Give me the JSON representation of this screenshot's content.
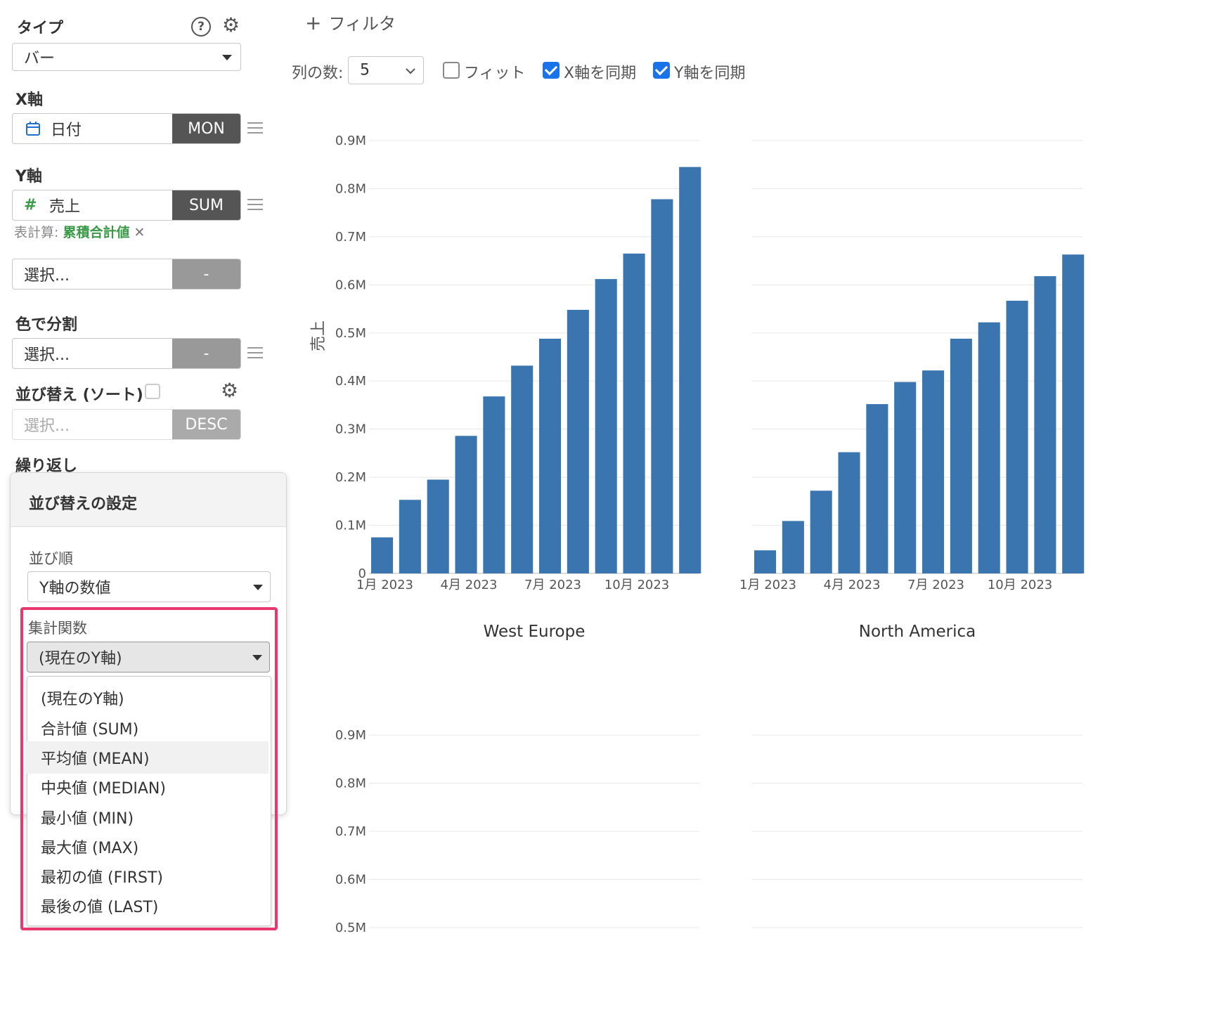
{
  "sidebar": {
    "type_title": "タイプ",
    "type_value": "バー",
    "xaxis_title": "X軸",
    "xaxis_field": "日付",
    "xaxis_agg": "MON",
    "yaxis_title": "Y軸",
    "yaxis_field": "売上",
    "yaxis_agg": "SUM",
    "table_calc_label": "表計算:",
    "table_calc_value": "累積合計値",
    "extra_select": "選択...",
    "extra_select_agg": "-",
    "color_title": "色で分割",
    "color_select": "選択...",
    "color_agg": "-",
    "sort_title": "並び替え (ソート)",
    "sort_select": "選択...",
    "sort_agg": "DESC",
    "repeat_title": "繰り返し"
  },
  "sort_panel": {
    "title": "並び替えの設定",
    "order_label": "並び順",
    "order_value": "Y軸の数値",
    "agg_label": "集計関数",
    "agg_value": "(現在のY軸)",
    "options": [
      "(現在のY軸)",
      "合計値 (SUM)",
      "平均値 (MEAN)",
      "中央値 (MEDIAN)",
      "最小値 (MIN)",
      "最大値 (MAX)",
      "最初の値 (FIRST)",
      "最後の値 (LAST)"
    ],
    "hovered_option": "平均値 (MEAN)"
  },
  "toolbar": {
    "add_filter": "フィルタ",
    "columns_label": "列の数:",
    "columns_value": "5",
    "fit_label": "フィット",
    "fit_checked": false,
    "sync_x_label": "X軸を同期",
    "sync_x_checked": true,
    "sync_y_label": "Y軸を同期",
    "sync_y_checked": true
  },
  "colors": {
    "bar": "#3b75af",
    "highlight": "#e8386d",
    "agg_dark": "#555555",
    "accent_green": "#3a9a48"
  },
  "chart_data": [
    {
      "type": "bar",
      "title": "West Europe",
      "ylabel": "売上",
      "ylim": [
        0,
        900000
      ],
      "y_ticks": [
        "0",
        "0.1M",
        "0.2M",
        "0.3M",
        "0.4M",
        "0.5M",
        "0.6M",
        "0.7M",
        "0.8M",
        "0.9M"
      ],
      "x_ticks": [
        "1月 2023",
        "4月 2023",
        "7月 2023",
        "10月 2023"
      ],
      "x": [
        "2023-01",
        "2023-02",
        "2023-03",
        "2023-04",
        "2023-05",
        "2023-06",
        "2023-07",
        "2023-08",
        "2023-09",
        "2023-10",
        "2023-11",
        "2023-12"
      ],
      "values": [
        75000,
        153000,
        195000,
        286000,
        368000,
        432000,
        488000,
        548000,
        612000,
        665000,
        778000,
        845000
      ]
    },
    {
      "type": "bar",
      "title": "North America",
      "ylim": [
        0,
        900000
      ],
      "x_ticks": [
        "1月 2023",
        "4月 2023",
        "7月 2023",
        "10月 2023"
      ],
      "x": [
        "2023-01",
        "2023-02",
        "2023-03",
        "2023-04",
        "2023-05",
        "2023-06",
        "2023-07",
        "2023-08",
        "2023-09",
        "2023-10",
        "2023-11",
        "2023-12"
      ],
      "values": [
        48000,
        109000,
        172000,
        252000,
        352000,
        398000,
        422000,
        488000,
        522000,
        567000,
        618000,
        663000
      ]
    },
    {
      "type": "bar",
      "y_ticks": [
        "0.5M",
        "0.6M",
        "0.7M",
        "0.8M",
        "0.9M"
      ],
      "ylim": [
        500000,
        900000
      ],
      "values": []
    },
    {
      "type": "bar",
      "ylim": [
        500000,
        900000
      ],
      "values": []
    }
  ]
}
